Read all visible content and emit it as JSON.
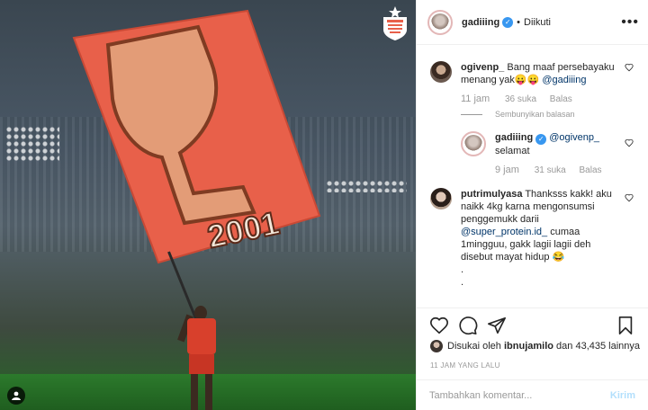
{
  "photo": {
    "description_icon": "expand-icon",
    "flag_text": "2001",
    "club_logo": "persija-logo"
  },
  "header": {
    "username": "gadiiing",
    "separator": "•",
    "follow_status": "Diikuti",
    "more": "•••"
  },
  "comments": [
    {
      "username": "ogivenp_",
      "text": "Bang maaf persebayaku menang yak😛😛",
      "mention": "@gadiiing",
      "time": "11 jam",
      "likes": "36 suka",
      "reply": "Balas",
      "hide_replies": "Sembunyikan balasan",
      "replies": [
        {
          "username": "gadiiing",
          "mention": "@ogivenp_",
          "text": "selamat",
          "time": "9 jam",
          "likes": "31 suka",
          "reply": "Balas"
        }
      ]
    },
    {
      "username": "putrimulyasa",
      "text": "Thanksss kakk! aku naikk 4kg karna mengonsumsi penggemukk darii",
      "mention": "@super_protein.id_",
      "text2": "cumaa 1mingguu, gakk lagii lagii deh disebut mayat hidup 😂",
      "trail1": ".",
      "trail2": "."
    }
  ],
  "likes": {
    "prefix": "Disukai oleh",
    "user": "ibnujamilo",
    "suffix": "dan 43,435 lainnya"
  },
  "posted": "11 JAM YANG LALU",
  "comment_box": {
    "placeholder": "Tambahkan komentar...",
    "send_label": "Kirim"
  },
  "colors": {
    "flag": "#e8604a",
    "verified": "#3897f0",
    "mention": "#003569",
    "send_disabled": "#b2dffc"
  }
}
